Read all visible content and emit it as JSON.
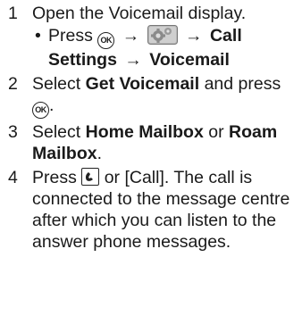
{
  "steps": [
    {
      "number": "1",
      "text": "Open the Voicemail display.",
      "sub": {
        "bullet": "•",
        "press": "Press",
        "arrow1": "→",
        "arrow2": "→",
        "call_settings": "Call Settings",
        "arrow3": "→",
        "voicemail": "Voicemail"
      }
    },
    {
      "number": "2",
      "select": "Select",
      "get_voicemail": "Get Voicemail",
      "and_press": "and press",
      "period": "."
    },
    {
      "number": "3",
      "select": "Select",
      "home_mailbox": "Home Mailbox",
      "or": "or",
      "roam_mailbox": "Roam Mailbox",
      "period": "."
    },
    {
      "number": "4",
      "press": "Press",
      "call_key_text": "or [Call]. The call is connected to the message centre after which you can listen to the answer phone messages."
    }
  ],
  "keys": {
    "ok_label": "OK"
  },
  "icons": {
    "ok_key": "ok-key-icon",
    "settings": "settings-menu-icon",
    "call_key": "call-key-icon"
  }
}
